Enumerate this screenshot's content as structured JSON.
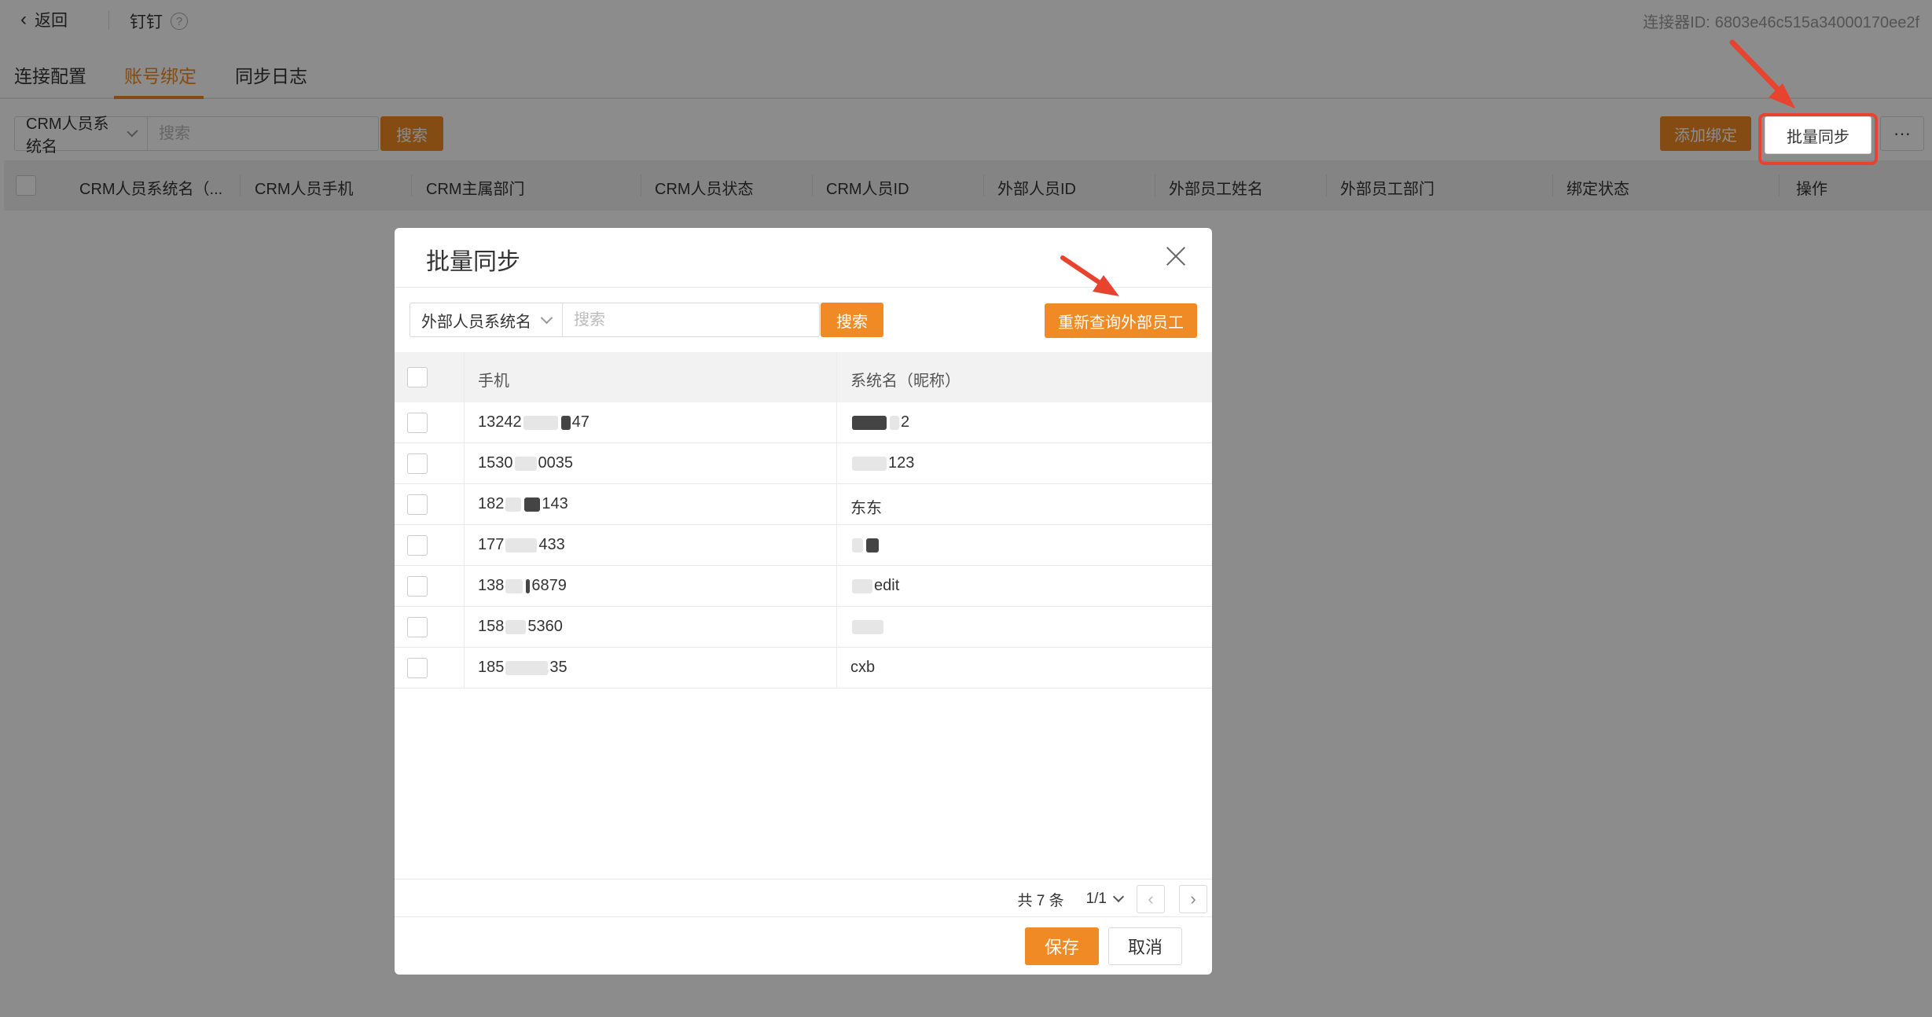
{
  "header": {
    "back_label": "返回",
    "app_name": "钉钉",
    "connector_label": "连接器ID:",
    "connector_id": "6803e46c515a34000170ee2f"
  },
  "tabs": [
    {
      "label": "连接配置"
    },
    {
      "label": "账号绑定",
      "active": true
    },
    {
      "label": "同步日志"
    }
  ],
  "filter": {
    "select_label": "CRM人员系统名",
    "search_placeholder": "搜索",
    "search_button": "搜索"
  },
  "toolbar": {
    "add_binding": "添加绑定",
    "batch_sync": "批量同步",
    "more": "···"
  },
  "table": {
    "columns": [
      "CRM人员系统名（...",
      "CRM人员手机",
      "CRM主属部门",
      "CRM人员状态",
      "CRM人员ID",
      "外部人员ID",
      "外部员工姓名",
      "外部员工部门",
      "绑定状态",
      "操作"
    ]
  },
  "modal": {
    "title": "批量同步",
    "filter_select": "外部人员系统名",
    "search_placeholder": "搜索",
    "search_button": "搜索",
    "refresh_button": "重新查询外部员工",
    "columns": {
      "phone": "手机",
      "name": "系统名（昵称）"
    },
    "rows": [
      {
        "phone_start": "13242",
        "phone_end": "47",
        "name_start": "",
        "name_end": "2"
      },
      {
        "phone_start": "1530",
        "phone_end": "0035",
        "name_start": "",
        "name_end": "123"
      },
      {
        "phone_start": "182",
        "phone_end": "143",
        "name_start": "东东",
        "name_end": ""
      },
      {
        "phone_start": "177",
        "phone_end": "433",
        "name_start": "",
        "name_end": ""
      },
      {
        "phone_start": "138",
        "phone_end": "6879",
        "name_start": "",
        "name_end": "edit"
      },
      {
        "phone_start": "158",
        "phone_end": "5360",
        "name_start": "",
        "name_end": ""
      },
      {
        "phone_start": "185",
        "phone_end": "35",
        "name_start": "cxb",
        "name_end": ""
      }
    ],
    "pagination": {
      "total": "共 7 条",
      "page": "1/1",
      "prev": "‹",
      "next": "›"
    },
    "save_button": "保存",
    "cancel_button": "取消"
  },
  "colors": {
    "accent": "#f08a24",
    "annotation_red": "#e8432e"
  }
}
